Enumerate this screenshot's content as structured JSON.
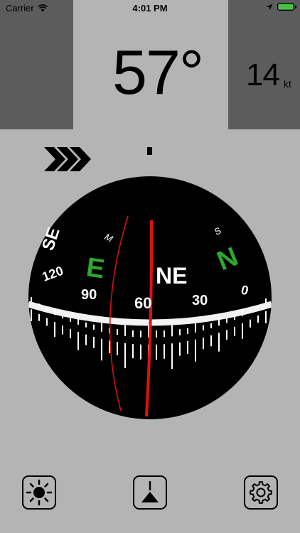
{
  "status_bar": {
    "carrier": "Carrier",
    "time": "4:01 PM",
    "icons": [
      "wifi-icon",
      "location-arrow-icon",
      "battery-icon"
    ],
    "battery_color": "#3ec83e"
  },
  "display": {
    "heading": "57°",
    "speed": "14",
    "speed_unit": "kt"
  },
  "compass": {
    "cardinals": [
      {
        "label": "SE",
        "color": "#ffffff"
      },
      {
        "label": "E",
        "color": "#2ea82e"
      },
      {
        "label": "NE",
        "color": "#ffffff"
      },
      {
        "label": "N",
        "color": "#2ea82e"
      }
    ],
    "small_labels": [
      "M",
      "S"
    ],
    "degree_labels": [
      "120",
      "90",
      "60",
      "30",
      "0"
    ],
    "needle_color": "#e01010"
  },
  "toolbar": {
    "buttons": [
      {
        "name": "brightness",
        "icon": "sun-icon"
      },
      {
        "name": "mode",
        "icon": "compass-mode-icon"
      },
      {
        "name": "settings",
        "icon": "gear-icon"
      }
    ]
  },
  "colors": {
    "background": "#b4b4b4",
    "side_panels": "#5c5c5c",
    "compass_face": "#000000",
    "accent_green": "#2ea82e",
    "needle_red": "#e01010"
  }
}
